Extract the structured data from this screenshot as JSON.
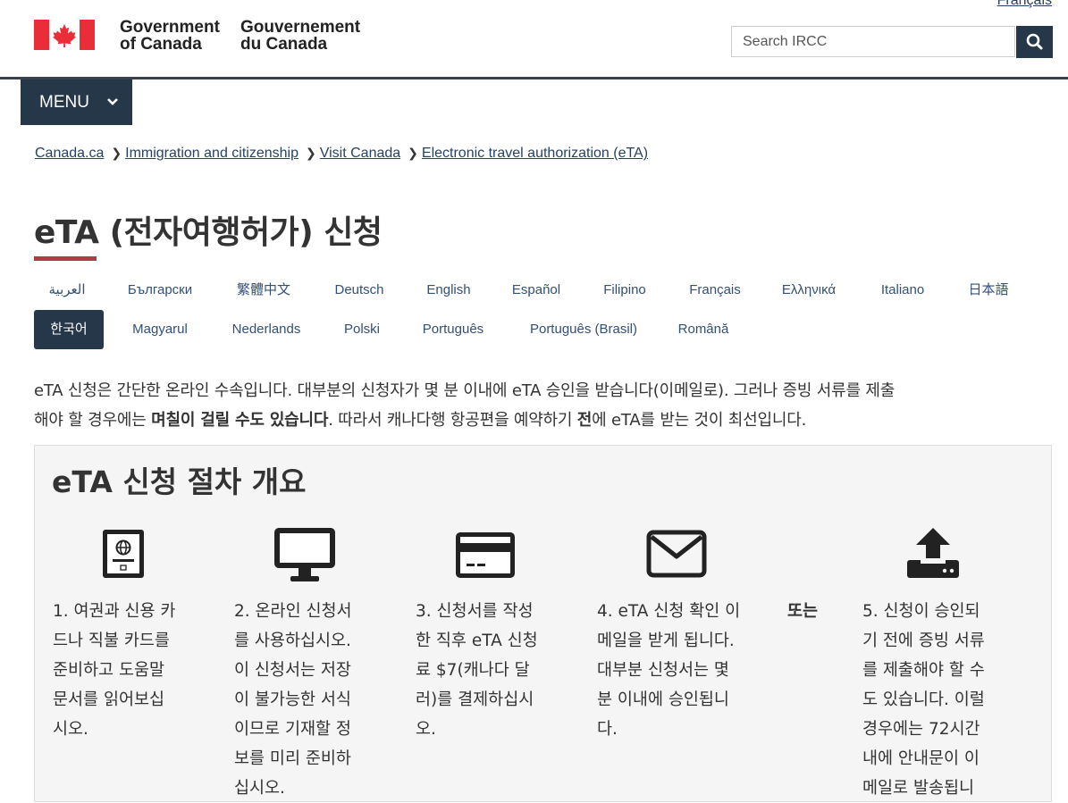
{
  "header": {
    "language_toggle": "Français",
    "signature_en": [
      "Government",
      "of Canada"
    ],
    "signature_fr": [
      "Gouvernement",
      "du Canada"
    ],
    "search_placeholder": "Search IRCC",
    "menu_label": "MENU"
  },
  "breadcrumb": [
    "Canada.ca",
    "Immigration and citizenship",
    "Visit Canada",
    "Electronic travel authorization (eTA)"
  ],
  "page": {
    "title": "eTA (전자여행허가) 신청"
  },
  "languages": {
    "row1": [
      "العربية",
      "Български",
      "繁體中文",
      "Deutsch",
      "English",
      "Español",
      "Filipino",
      "Français",
      "Ελληνικά",
      "Italiano",
      "日本語"
    ],
    "row2": [
      "한국어",
      "Magyarul",
      "Nederlands",
      "Polski",
      "Português",
      "Português (Brasil)",
      "Română"
    ],
    "selected": "한국어"
  },
  "intro": {
    "p1": "eTA 신청은 간단한 온라인 수속입니다. 대부분의 신청자가 몇 분 이내에 eTA 승인을 받습니다(이메일로). 그러나 증빙 서류를 제출",
    "p2a": "해야 할 경우에는 ",
    "p2b": "며칠이 걸릴 수도 있습니다",
    "p2c": ". 따라서 캐나다행 항공편을 예약하기 ",
    "p2d": "전",
    "p2e": "에 eTA를 받는 것이 최선입니다."
  },
  "overview": {
    "heading": "eTA 신청 절차 개요",
    "or_label": "또는",
    "steps": [
      {
        "icon": "passport-icon",
        "lines": [
          "1. 여권과 신용 카",
          "드나 직불 카드를",
          "준비하고 도움말",
          "문서를 읽어보십",
          "시오."
        ]
      },
      {
        "icon": "monitor-icon",
        "lines": [
          "2. 온라인 신청서",
          "를 사용하십시오.",
          "이 신청서는 저장",
          "이 불가능한 서식",
          "이므로 기재할 정",
          "보를 미리 준비하",
          "십시오."
        ]
      },
      {
        "icon": "credit-card-icon",
        "lines": [
          "3. 신청서를 작성",
          "한 직후 eTA 신청",
          "료 $7(캐나다 달",
          "러)를 결제하십시",
          "오."
        ]
      },
      {
        "icon": "envelope-icon",
        "lines": [
          "4. eTA 신청 확인 이",
          "메일을 받게 됩니다.",
          "대부분 신청서는 몇",
          "분 이내에 승인됩니",
          "다."
        ]
      },
      {
        "icon": "upload-icon",
        "lines": [
          "5. 신청이 승인되",
          "기 전에 증빙 서류",
          "를 제출해야 할 수",
          "도 있습니다. 이럴",
          "경우에는 72시간",
          "내에 안내문이 이",
          "메일로 발송됩니"
        ]
      }
    ]
  },
  "colors": {
    "brand_dark": "#26374a",
    "link": "#284162",
    "accent_red": "#af3c43",
    "flag_red": "#eb2d37"
  }
}
